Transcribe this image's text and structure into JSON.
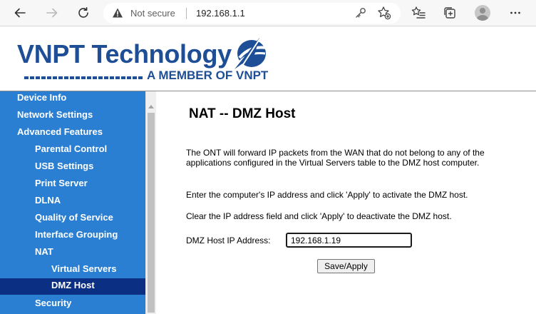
{
  "browser": {
    "security_label": "Not secure",
    "url": "192.168.1.1"
  },
  "logo": {
    "main": "VNPT Technology",
    "sub": "A MEMBER OF VNPT",
    "brand_color": "#1d4e96"
  },
  "sidebar": {
    "bg_color": "#2a7fd2",
    "active_color": "#0b2f83",
    "items": [
      {
        "label": "Device Info",
        "level": 0
      },
      {
        "label": "Network Settings",
        "level": 0
      },
      {
        "label": "Advanced Features",
        "level": 0
      },
      {
        "label": "Parental Control",
        "level": 1
      },
      {
        "label": "USB Settings",
        "level": 1
      },
      {
        "label": "Print Server",
        "level": 1
      },
      {
        "label": "DLNA",
        "level": 1
      },
      {
        "label": "Quality of Service",
        "level": 1
      },
      {
        "label": "Interface Grouping",
        "level": 1
      },
      {
        "label": "NAT",
        "level": 1
      },
      {
        "label": "Virtual Servers",
        "level": 2
      },
      {
        "label": "DMZ Host",
        "level": 2,
        "active": true
      },
      {
        "label": "Security",
        "level": 1
      }
    ]
  },
  "main": {
    "title": "NAT -- DMZ Host",
    "description": "The ONT will forward IP packets from the WAN that do not belong to any of the applications configured in the Virtual Servers table to the DMZ host computer.",
    "activate_hint": "Enter the computer's IP address and click 'Apply' to activate the DMZ host.",
    "deactivate_hint": "Clear the IP address field and click 'Apply' to deactivate the DMZ host.",
    "ip_label": "DMZ Host IP Address:",
    "ip_value": "192.168.1.19",
    "apply_label": "Save/Apply"
  }
}
